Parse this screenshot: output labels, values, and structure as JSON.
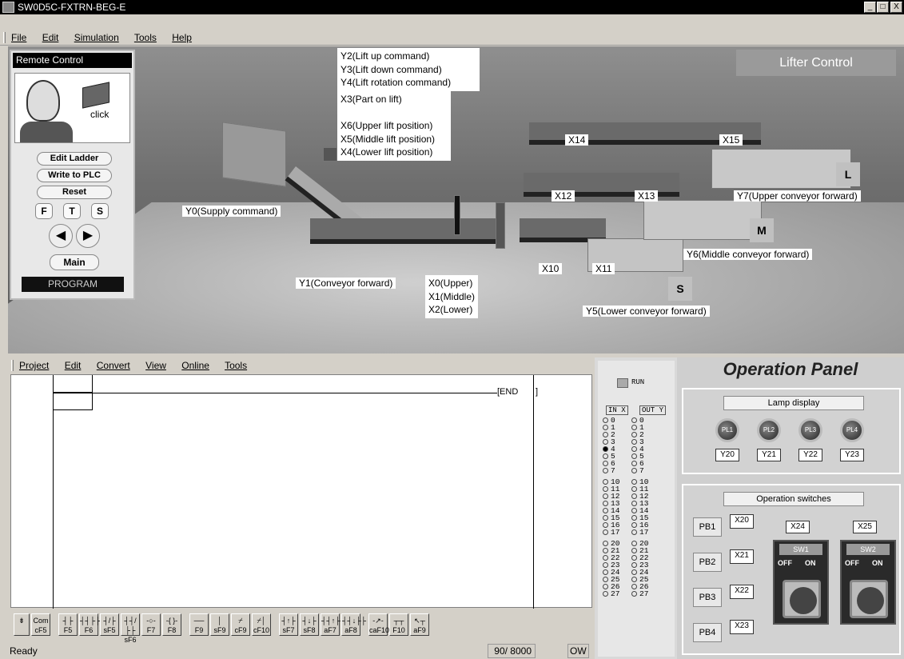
{
  "window": {
    "title": "SW0D5C-FXTRN-BEG-E",
    "min": "_",
    "max": "□",
    "close": "X"
  },
  "menu": [
    "File",
    "Edit",
    "Simulation",
    "Tools",
    "Help"
  ],
  "remote": {
    "title": "Remote Control",
    "click": "click",
    "edit_ladder": "Edit Ladder",
    "write_plc": "Write to PLC",
    "reset": "Reset",
    "f": "F",
    "t": "T",
    "s": "S",
    "prev": "◀",
    "next": "▶",
    "main": "Main",
    "mode": "PROGRAM"
  },
  "scene": {
    "lifter_title": "Lifter Control",
    "lift_cmds": [
      "Y2(Lift up command)",
      "Y3(Lift down command)",
      "Y4(Lift rotation command)"
    ],
    "lift_sensors": [
      "X3(Part on lift)",
      "",
      "X6(Upper lift position)",
      "X5(Middle lift position)",
      "X4(Lower lift position)"
    ],
    "supply": "Y0(Supply command)",
    "conveyor": "Y1(Conveyor forward)",
    "heights": [
      "X0(Upper)",
      "X1(Middle)",
      "X2(Lower)"
    ],
    "x10": "X10",
    "x11": "X11",
    "x12": "X12",
    "x13": "X13",
    "x14": "X14",
    "x15": "X15",
    "y5": "Y5(Lower conveyor forward)",
    "y6": "Y6(Middle conveyor forward)",
    "y7": "Y7(Upper conveyor forward)",
    "box_l": "L",
    "box_m": "M",
    "box_s": "S"
  },
  "editor": {
    "menu": [
      "Project",
      "Edit",
      "Convert",
      "View",
      "Online",
      "Tools"
    ],
    "end": "[END",
    "toolbar": [
      {
        "sym": "⇟",
        "key": ""
      },
      {
        "sym": "Com",
        "key": "cF5"
      },
      {
        "sym": "┤├",
        "key": "F5"
      },
      {
        "sym": "┤┤├├",
        "key": "F6"
      },
      {
        "sym": "┤/├",
        "key": "sF5"
      },
      {
        "sym": "┤┤/├├",
        "key": "sF6"
      },
      {
        "sym": "-○-",
        "key": "F7"
      },
      {
        "sym": "-{ }-",
        "key": "F8"
      },
      {
        "sym": "──",
        "key": "F9"
      },
      {
        "sym": "│",
        "key": "sF9"
      },
      {
        "sym": "⌿",
        "key": "cF9"
      },
      {
        "sym": "⌿│",
        "key": "cF10"
      },
      {
        "sym": "┤↑├",
        "key": "sF7"
      },
      {
        "sym": "┤↓├",
        "key": "sF8"
      },
      {
        "sym": "┤┤↑├├",
        "key": "aF7"
      },
      {
        "sym": "┤┤↓├├",
        "key": "aF8"
      },
      {
        "sym": "-↗-",
        "key": "caF10"
      },
      {
        "sym": "┬┬",
        "key": "F10"
      },
      {
        "sym": "↖┬",
        "key": "aF9"
      }
    ],
    "status_left": "Ready",
    "status_count": "90/ 8000",
    "status_mode": "OW"
  },
  "io": {
    "run": "RUN",
    "in": "IN X",
    "out": "OUT Y",
    "rows": [
      "0",
      "1",
      "2",
      "3",
      "4",
      "5",
      "6",
      "7",
      "",
      "10",
      "11",
      "12",
      "13",
      "14",
      "15",
      "16",
      "17",
      "",
      "20",
      "21",
      "22",
      "23",
      "24",
      "25",
      "26",
      "27"
    ],
    "active_in": "4"
  },
  "panel": {
    "title": "Operation Panel",
    "lamp_title": "Lamp display",
    "lamps": [
      {
        "name": "PL1",
        "out": "Y20"
      },
      {
        "name": "PL2",
        "out": "Y21"
      },
      {
        "name": "PL3",
        "out": "Y22"
      },
      {
        "name": "PL4",
        "out": "Y23"
      }
    ],
    "switch_title": "Operation switches",
    "pbs": [
      {
        "name": "PB1",
        "in": "X20"
      },
      {
        "name": "PB2",
        "in": "X21"
      },
      {
        "name": "PB3",
        "in": "X22"
      },
      {
        "name": "PB4",
        "in": "X23"
      }
    ],
    "sws": [
      {
        "name": "SW1",
        "in": "X24",
        "off": "OFF",
        "on": "ON"
      },
      {
        "name": "SW2",
        "in": "X25",
        "off": "OFF",
        "on": "ON"
      }
    ]
  }
}
